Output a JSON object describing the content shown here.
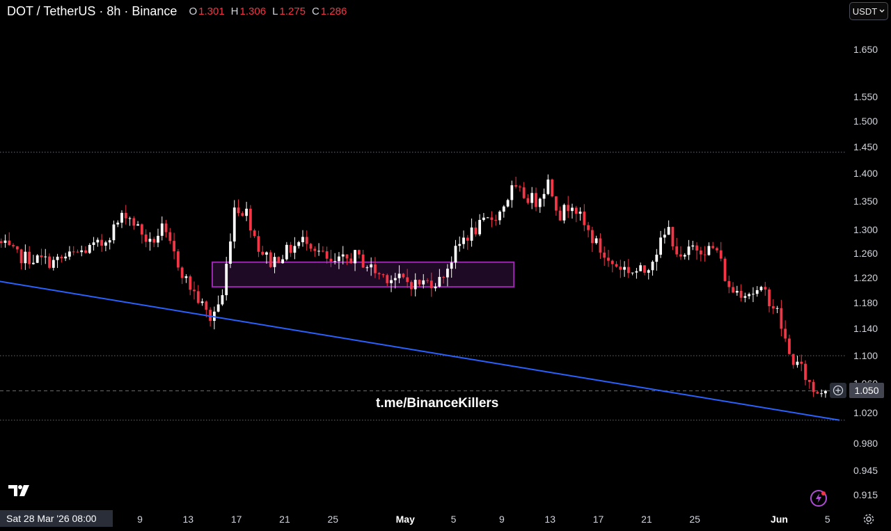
{
  "header": {
    "title": "DOT / TetherUS · 8h · Binance",
    "ohlc": [
      {
        "label": "O",
        "value": "1.301"
      },
      {
        "label": "H",
        "value": "1.306"
      },
      {
        "label": "L",
        "value": "1.275"
      },
      {
        "label": "C",
        "value": "1.286"
      }
    ]
  },
  "currency_selector": {
    "label": "USDT",
    "icon": "chevron-down-icon"
  },
  "watermark": "t.me/BinanceKillers",
  "current_price": {
    "label": "1.050",
    "icon": "plus-circle-icon"
  },
  "start_date_label": "Sat 28 Mar '26   08:00",
  "colors": {
    "background": "#000000",
    "up": "#ffffff",
    "down": "#f23645",
    "trendline": "#2962ff",
    "zone_border": "#9c27b0",
    "zone_fill": "#1e0a24"
  },
  "icons": {
    "logo": "tradingview-logo-icon",
    "bolt": "lightning-bolt-icon",
    "settings": "gear-icon"
  },
  "chart_data": {
    "type": "candlestick",
    "symbol": "DOT / TetherUS",
    "interval": "8h",
    "exchange": "Binance",
    "y_axis_ticks": [
      "1.650",
      "1.550",
      "1.500",
      "1.450",
      "1.400",
      "1.350",
      "1.300",
      "1.260",
      "1.220",
      "1.180",
      "1.140",
      "1.100",
      "1.060",
      "1.020",
      "0.980",
      "0.945",
      "0.915"
    ],
    "y_axis_scale": "log",
    "x_axis_ticks": [
      {
        "label": "9",
        "date": "2026-04-09",
        "bold": false
      },
      {
        "label": "13",
        "date": "2026-04-13",
        "bold": false
      },
      {
        "label": "17",
        "date": "2026-04-17",
        "bold": false
      },
      {
        "label": "21",
        "date": "2026-04-21",
        "bold": false
      },
      {
        "label": "25",
        "date": "2026-04-25",
        "bold": false
      },
      {
        "label": "May",
        "date": "2026-05-01",
        "bold": true
      },
      {
        "label": "5",
        "date": "2026-05-05",
        "bold": false
      },
      {
        "label": "9",
        "date": "2026-05-09",
        "bold": false
      },
      {
        "label": "13",
        "date": "2026-05-13",
        "bold": false
      },
      {
        "label": "17",
        "date": "2026-05-17",
        "bold": false
      },
      {
        "label": "21",
        "date": "2026-05-21",
        "bold": false
      },
      {
        "label": "25",
        "date": "2026-05-25",
        "bold": false
      },
      {
        "label": "Jun",
        "date": "2026-06-01",
        "bold": true
      },
      {
        "label": "5",
        "date": "2026-06-05",
        "bold": false
      }
    ],
    "horizontal_levels": [
      {
        "price": 1.44,
        "style": "dotted"
      },
      {
        "price": 1.1,
        "style": "dotted"
      },
      {
        "price": 1.05,
        "style": "dashed"
      },
      {
        "price": 1.01,
        "style": "dotted"
      }
    ],
    "trendline": {
      "start": {
        "date": "2026-03-28",
        "price": 1.215
      },
      "end": {
        "date": "2026-06-06",
        "price": 1.01
      }
    },
    "zone": {
      "start_date": "2026-04-15",
      "end_date": "2026-05-10",
      "top": 1.245,
      "bottom": 1.205
    },
    "grid": false,
    "last_price": 1.05
  }
}
